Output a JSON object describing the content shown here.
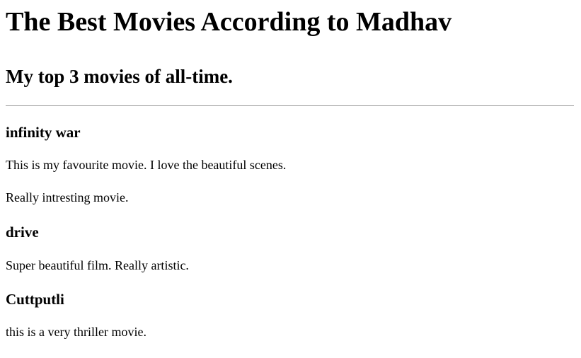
{
  "page": {
    "title": "The Best Movies According to Madhav",
    "subtitle": "My top 3 movies of all-time."
  },
  "movies": [
    {
      "title": "infinity war",
      "paragraphs": [
        "This is my favourite movie. I love the beautiful scenes.",
        "Really intresting movie."
      ]
    },
    {
      "title": "drive",
      "paragraphs": [
        "Super beautiful film. Really artistic."
      ]
    },
    {
      "title": "Cuttputli",
      "paragraphs": [
        "this is a very thriller movie."
      ]
    }
  ]
}
